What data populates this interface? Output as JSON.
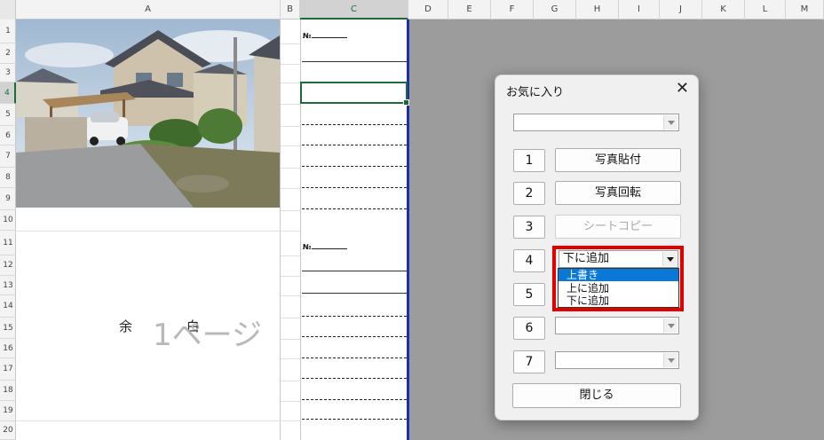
{
  "columns": [
    "A",
    "B",
    "C",
    "D",
    "E",
    "F",
    "G",
    "H",
    "I",
    "J",
    "K",
    "L",
    "M"
  ],
  "selected_column": "C",
  "rows": [
    "1",
    "2",
    "3",
    "4",
    "5",
    "6",
    "7",
    "8",
    "9",
    "10",
    "11",
    "12",
    "13",
    "14",
    "15",
    "16",
    "17",
    "18",
    "19",
    "20"
  ],
  "selected_row": "4",
  "no_label": "№",
  "margin_text": "余 白",
  "page_text": "1ページ",
  "dialog": {
    "title": "お気に入り",
    "close_icon": "close-icon",
    "top_combo_value": "",
    "buttons": [
      {
        "num": "1",
        "label": "写真貼付",
        "enabled": true
      },
      {
        "num": "2",
        "label": "写真回転",
        "enabled": true
      },
      {
        "num": "3",
        "label": "シートコピー",
        "enabled": false
      }
    ],
    "row4": {
      "num": "4",
      "combo_value": "下に追加"
    },
    "dropdown_options": [
      "上書き",
      "上に追加",
      "下に追加"
    ],
    "dropdown_highlighted": "上書き",
    "row5": {
      "num": "5"
    },
    "row6": {
      "num": "6",
      "combo_value": ""
    },
    "row7": {
      "num": "7",
      "combo_value": ""
    },
    "close_button": "閉じる"
  },
  "colors": {
    "accent_red": "#e00000",
    "select_blue": "#0a78d7",
    "excel_green": "#1e6b3a",
    "print_border_blue": "#1b2fa8"
  }
}
